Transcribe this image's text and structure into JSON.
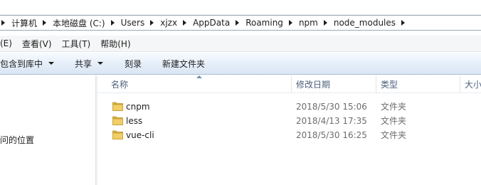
{
  "breadcrumb": {
    "segments": [
      "计算机",
      "本地磁盘 (C:)",
      "Users",
      "xjzx",
      "AppData",
      "Roaming",
      "npm",
      "node_modules"
    ]
  },
  "menu": {
    "items": [
      "(E)",
      "查看(V)",
      "工具(T)",
      "帮助(H)"
    ]
  },
  "toolbar": {
    "include_label": "包含到库中",
    "share_label": "共享",
    "burn_label": "刻录",
    "new_folder_label": "新建文件夹"
  },
  "nav": {
    "item_label": "问的位置"
  },
  "columns": {
    "name": "名称",
    "date": "修改日期",
    "type": "类型",
    "size": "大小"
  },
  "files": [
    {
      "name": "cnpm",
      "date": "2018/5/30 15:06",
      "type": "文件夹"
    },
    {
      "name": "less",
      "date": "2018/4/13 17:35",
      "type": "文件夹"
    },
    {
      "name": "vue-cli",
      "date": "2018/5/30 16:25",
      "type": "文件夹"
    }
  ],
  "colors": {
    "folder_body": "#e9c65a",
    "folder_back": "#d9ad3c",
    "header_text": "#4c607a",
    "secondary_text": "#6d6d6d"
  },
  "icons": {
    "breadcrumb_separator": "chevron-right-icon",
    "dropdown": "caret-down-icon",
    "folder": "folder-icon"
  }
}
